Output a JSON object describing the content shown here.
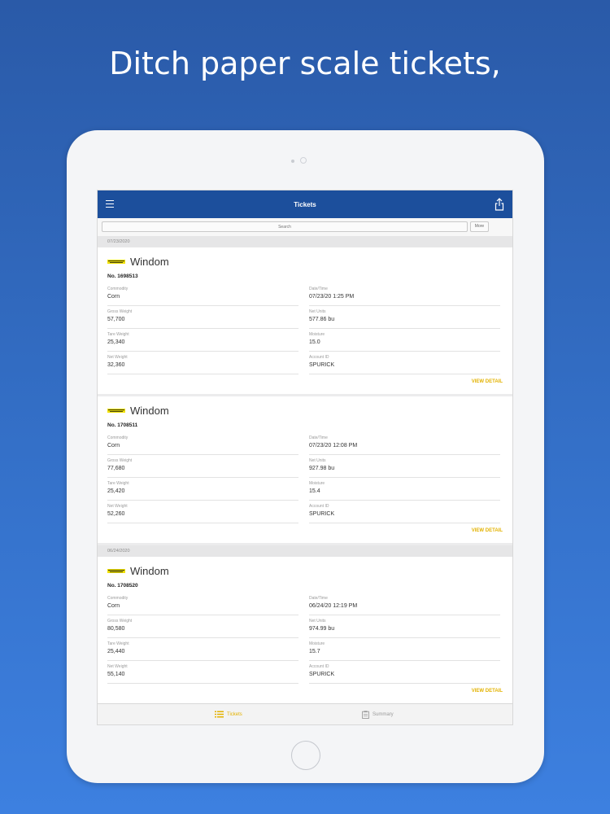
{
  "headline": "Ditch paper scale tickets,",
  "app": {
    "nav_title": "Tickets",
    "search_placeholder": "Search",
    "more_label": "More"
  },
  "groups": [
    {
      "date": "07/23/2020",
      "tickets": [
        {
          "location": "Windom",
          "number": "No. 1698513",
          "fields": [
            {
              "label": "Commodity",
              "value": "Corn"
            },
            {
              "label": "Date/Time",
              "value": "07/23/20 1:25 PM"
            },
            {
              "label": "Gross Weight",
              "value": "57,700"
            },
            {
              "label": "Net Units",
              "value": "577.86 bu"
            },
            {
              "label": "Tare Weight",
              "value": "25,340"
            },
            {
              "label": "Moisture",
              "value": "15.0"
            },
            {
              "label": "Net Weight",
              "value": "32,360"
            },
            {
              "label": "Account ID",
              "value": "SPURICK"
            }
          ],
          "action": "VIEW DETAIL"
        },
        {
          "location": "Windom",
          "number": "No. 1708511",
          "fields": [
            {
              "label": "Commodity",
              "value": "Corn"
            },
            {
              "label": "Date/Time",
              "value": "07/23/20 12:08 PM"
            },
            {
              "label": "Gross Weight",
              "value": "77,680"
            },
            {
              "label": "Net Units",
              "value": "927.98 bu"
            },
            {
              "label": "Tare Weight",
              "value": "25,420"
            },
            {
              "label": "Moisture",
              "value": "15.4"
            },
            {
              "label": "Net Weight",
              "value": "52,260"
            },
            {
              "label": "Account ID",
              "value": "SPURICK"
            }
          ],
          "action": "VIEW DETAIL"
        }
      ]
    },
    {
      "date": "06/24/2020",
      "tickets": [
        {
          "location": "Windom",
          "number": "No. 1708520",
          "fields": [
            {
              "label": "Commodity",
              "value": "Corn"
            },
            {
              "label": "Date/Time",
              "value": "06/24/20 12:19 PM"
            },
            {
              "label": "Gross Weight",
              "value": "80,580"
            },
            {
              "label": "Net Units",
              "value": "974.99 bu"
            },
            {
              "label": "Tare Weight",
              "value": "25,440"
            },
            {
              "label": "Moisture",
              "value": "15.7"
            },
            {
              "label": "Net Weight",
              "value": "55,140"
            },
            {
              "label": "Account ID",
              "value": "SPURICK"
            }
          ],
          "action": "VIEW DETAIL"
        }
      ]
    }
  ],
  "tabbar": {
    "tickets_label": "Tickets",
    "summary_label": "Summary"
  },
  "colors": {
    "navbar": "#1c4f9c",
    "accent": "#e3b200",
    "logo_yellow": "#f2e200"
  },
  "icons": [
    "menu-icon",
    "share-icon",
    "list-icon",
    "clipboard-icon",
    "company-logo"
  ]
}
